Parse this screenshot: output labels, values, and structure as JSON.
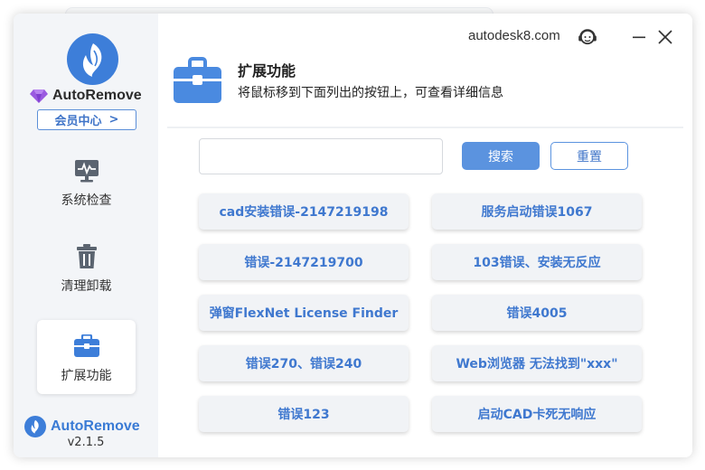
{
  "app": {
    "name": "AutoRemove",
    "version": "v2.1.5",
    "member_center": "会员中心",
    "member_arrow": ">"
  },
  "header": {
    "site": "autodesk8.com",
    "title": "扩展功能",
    "subtitle": "将鼠标移到下面列出的按钮上，可查看详细信息"
  },
  "sidebar": {
    "items": [
      {
        "label": "系统检查",
        "icon": "monitor-pulse-icon"
      },
      {
        "label": "清理卸载",
        "icon": "trash-icon"
      },
      {
        "label": "扩展功能",
        "icon": "toolbox-icon",
        "active": true
      }
    ]
  },
  "search": {
    "value": "",
    "placeholder": "",
    "search_label": "搜索",
    "reset_label": "重置"
  },
  "buttons": [
    "cad安装错误-2147219198",
    "服务启动错误1067",
    "错误-2147219700",
    "103错误、安装无反应",
    "弹窗FlexNet License Finder",
    "错误4005",
    "错误270、错误240",
    "Web浏览器 无法找到\"xxx\"",
    "错误123",
    "启动CAD卡死无响应"
  ],
  "colors": {
    "accent": "#3d7ed9",
    "button_text": "#3f78cf",
    "sidebar_bg": "#f3f5f8",
    "button_bg": "#f1f3f6"
  }
}
